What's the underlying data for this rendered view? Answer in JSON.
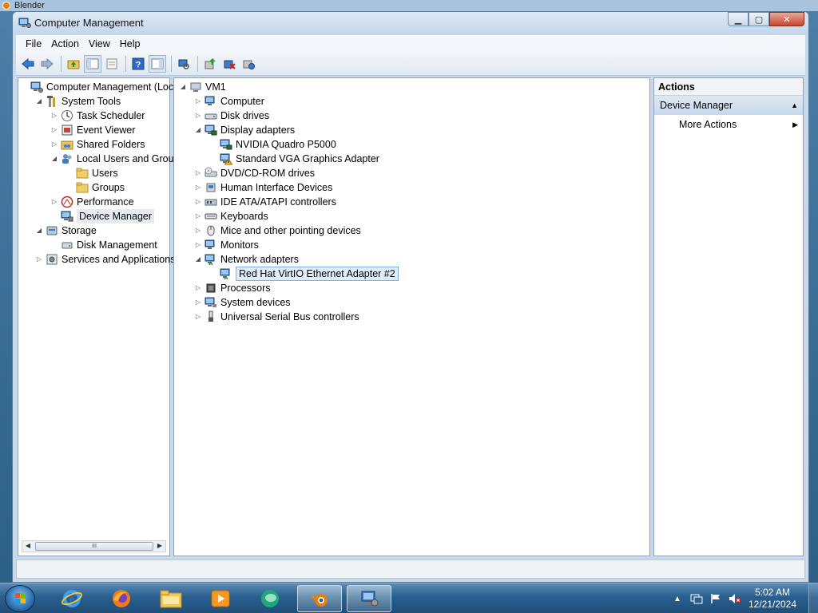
{
  "background_window": {
    "title": "Blender"
  },
  "window": {
    "title": "Computer Management",
    "controls": {
      "minimize": "▁",
      "maximize": "▢",
      "close": "✕"
    }
  },
  "menubar": {
    "items": [
      "File",
      "Action",
      "View",
      "Help"
    ]
  },
  "toolbar": {
    "buttons": [
      "back-icon",
      "forward-icon",
      "up-folder-icon",
      "show-hide-console-tree-icon",
      "properties-icon",
      "help-icon",
      "show-action-pane-icon",
      "scan-hardware-icon",
      "update-driver-icon",
      "uninstall-device-icon",
      "enable-device-icon"
    ]
  },
  "left_tree": {
    "items": [
      {
        "label": "Computer Management (Local",
        "level": 0,
        "toggle": "",
        "icon": "computer-management-icon"
      },
      {
        "label": "System Tools",
        "level": 1,
        "toggle": "◢",
        "icon": "system-tools-icon"
      },
      {
        "label": "Task Scheduler",
        "level": 2,
        "toggle": "▷",
        "icon": "task-scheduler-icon"
      },
      {
        "label": "Event Viewer",
        "level": 2,
        "toggle": "▷",
        "icon": "event-viewer-icon"
      },
      {
        "label": "Shared Folders",
        "level": 2,
        "toggle": "▷",
        "icon": "shared-folders-icon"
      },
      {
        "label": "Local Users and Groups",
        "level": 2,
        "toggle": "◢",
        "icon": "local-users-groups-icon"
      },
      {
        "label": "Users",
        "level": 3,
        "toggle": "",
        "icon": "folder-icon"
      },
      {
        "label": "Groups",
        "level": 3,
        "toggle": "",
        "icon": "folder-icon"
      },
      {
        "label": "Performance",
        "level": 2,
        "toggle": "▷",
        "icon": "performance-icon"
      },
      {
        "label": "Device Manager",
        "level": 2,
        "toggle": "",
        "icon": "device-manager-icon",
        "selected": true
      },
      {
        "label": "Storage",
        "level": 1,
        "toggle": "◢",
        "icon": "storage-icon"
      },
      {
        "label": "Disk Management",
        "level": 2,
        "toggle": "",
        "icon": "disk-management-icon"
      },
      {
        "label": "Services and Applications",
        "level": 1,
        "toggle": "▷",
        "icon": "services-applications-icon"
      }
    ],
    "scrollbar_thumb": "III"
  },
  "device_tree": {
    "items": [
      {
        "label": "VM1",
        "level": 0,
        "toggle": "◢",
        "icon": "computer-icon"
      },
      {
        "label": "Computer",
        "level": 1,
        "toggle": "▷",
        "icon": "computer-category-icon"
      },
      {
        "label": "Disk drives",
        "level": 1,
        "toggle": "▷",
        "icon": "disk-drive-icon"
      },
      {
        "label": "Display adapters",
        "level": 1,
        "toggle": "◢",
        "icon": "display-adapter-icon"
      },
      {
        "label": "NVIDIA Quadro P5000",
        "level": 2,
        "toggle": "",
        "icon": "display-adapter-icon"
      },
      {
        "label": "Standard VGA Graphics Adapter",
        "level": 2,
        "toggle": "",
        "icon": "display-adapter-warning-icon"
      },
      {
        "label": "DVD/CD-ROM drives",
        "level": 1,
        "toggle": "▷",
        "icon": "dvd-drive-icon"
      },
      {
        "label": "Human Interface Devices",
        "level": 1,
        "toggle": "▷",
        "icon": "hid-icon"
      },
      {
        "label": "IDE ATA/ATAPI controllers",
        "level": 1,
        "toggle": "▷",
        "icon": "ide-controller-icon"
      },
      {
        "label": "Keyboards",
        "level": 1,
        "toggle": "▷",
        "icon": "keyboard-icon"
      },
      {
        "label": "Mice and other pointing devices",
        "level": 1,
        "toggle": "▷",
        "icon": "mouse-icon"
      },
      {
        "label": "Monitors",
        "level": 1,
        "toggle": "▷",
        "icon": "monitor-icon"
      },
      {
        "label": "Network adapters",
        "level": 1,
        "toggle": "◢",
        "icon": "network-adapter-icon"
      },
      {
        "label": "Red Hat VirtIO Ethernet Adapter #2",
        "level": 2,
        "toggle": "",
        "icon": "network-adapter-icon",
        "selected": true
      },
      {
        "label": "Processors",
        "level": 1,
        "toggle": "▷",
        "icon": "processor-icon"
      },
      {
        "label": "System devices",
        "level": 1,
        "toggle": "▷",
        "icon": "system-devices-icon"
      },
      {
        "label": "Universal Serial Bus controllers",
        "level": 1,
        "toggle": "▷",
        "icon": "usb-icon"
      }
    ]
  },
  "actions": {
    "header": "Actions",
    "section": "Device Manager",
    "section_caret": "▲",
    "items": [
      {
        "label": "More Actions",
        "arrow": "▶"
      }
    ]
  },
  "taskbar": {
    "apps": [
      "internet-explorer-icon",
      "firefox-icon",
      "file-explorer-icon",
      "media-player-icon",
      "chat-app-icon",
      "blender-icon",
      "computer-management-app-icon"
    ],
    "active_app": "computer-management-app-icon",
    "tray": {
      "expand": "▲",
      "icons": [
        "action-center-icon",
        "flag-icon",
        "volume-muted-icon"
      ]
    },
    "clock": {
      "time": "5:02 AM",
      "date": "12/21/2024"
    }
  },
  "colors": {
    "selection_blue": "#dfeefc",
    "selection_border": "#7daee0",
    "actions_section": "#c8d9eb",
    "taskbar": "#2a5f8e"
  }
}
